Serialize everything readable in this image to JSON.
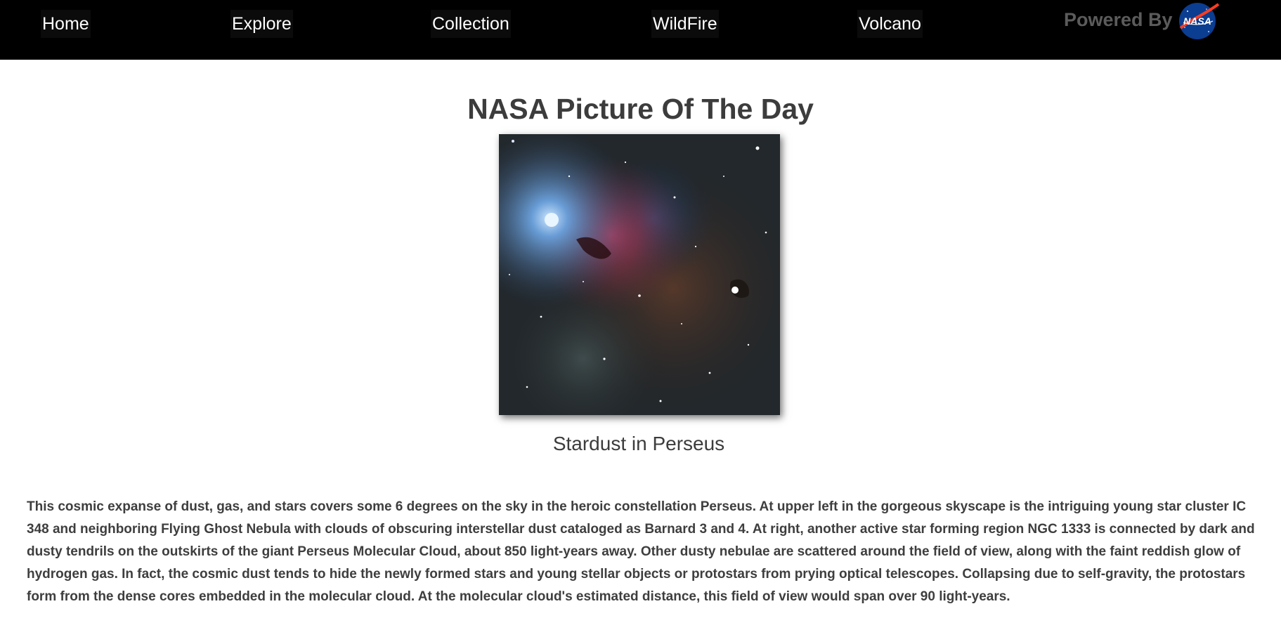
{
  "nav": {
    "items": [
      {
        "label": "Home"
      },
      {
        "label": "Explore"
      },
      {
        "label": "Collection"
      },
      {
        "label": "WildFire"
      },
      {
        "label": "Volcano"
      }
    ],
    "powered_by": "Powered By",
    "logo_text": "NASA",
    "logo_icon": "nasa-meatball-logo"
  },
  "main": {
    "title": "NASA Picture Of The Day",
    "picture_caption": "Stardust in Perseus",
    "explanation": "This cosmic expanse of dust, gas, and stars covers some 6 degrees on the sky in the heroic constellation Perseus. At upper left in the gorgeous skyscape is the intriguing young star cluster IC 348 and neighboring Flying Ghost Nebula with clouds of obscuring interstellar dust cataloged as Barnard 3 and 4. At right, another active star forming region NGC 1333 is connected by dark and dusty tendrils on the outskirts of the giant Perseus Molecular Cloud, about 850 light-years away. Other dusty nebulae are scattered around the field of view, along with the faint reddish glow of hydrogen gas. In fact, the cosmic dust tends to hide the newly formed stars and young stellar objects or protostars from prying optical telescopes. Collapsing due to self-gravity, the protostars form from the dense cores embedded in the molecular cloud. At the molecular cloud's estimated distance, this field of view would span over 90 light-years."
  },
  "colors": {
    "topbar_bg": "#000000",
    "nav_text": "#ffffff",
    "powered_text": "#5b5b5b",
    "body_text": "#3c3c3c",
    "nasa_blue": "#0b3d91",
    "nasa_red": "#fc3d21"
  }
}
